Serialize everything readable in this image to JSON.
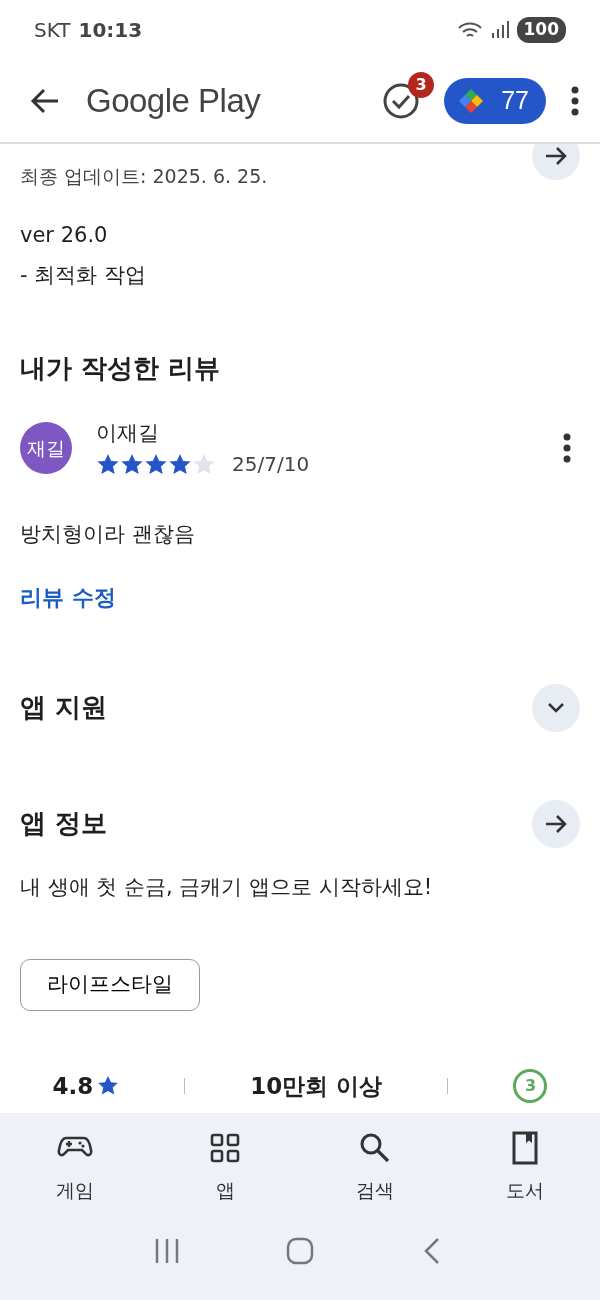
{
  "status_bar": {
    "carrier": "SKT",
    "time": "10:13",
    "battery": "100"
  },
  "app_bar": {
    "title": "Google Play",
    "notification_count": "3",
    "points": "77"
  },
  "whats_new": {
    "updated": "최종 업데이트: 2025. 6. 25.",
    "notes": [
      "ver 26.0",
      "- 최적화 작업"
    ]
  },
  "my_review": {
    "heading": "내가 작성한 리뷰",
    "avatar": "재길",
    "author": "이재길",
    "stars": 4,
    "date": "25/7/10",
    "text": "방치형이라 괜찮음",
    "edit_link": "리뷰 수정"
  },
  "app_support": {
    "heading": "앱 지원",
    "expanded": false
  },
  "app_info": {
    "heading": "앱 정보",
    "description": "내 생애 첫 순금, 금캐기 앱으로 시작하세요!",
    "category": "라이프스타일"
  },
  "stats": [
    {
      "kind": "rating",
      "value": "4.8"
    },
    {
      "kind": "text",
      "value": "10만회 이상"
    },
    {
      "kind": "age",
      "value": "3"
    }
  ],
  "bottom_nav": [
    {
      "kind": "game",
      "label": "게임"
    },
    {
      "kind": "apps",
      "label": "앱"
    },
    {
      "kind": "search",
      "label": "검색"
    },
    {
      "kind": "book",
      "label": "도서"
    }
  ]
}
